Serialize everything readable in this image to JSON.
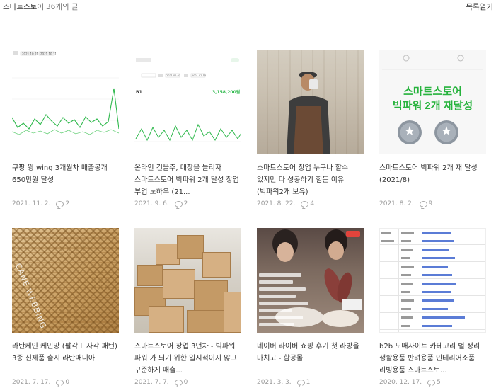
{
  "header": {
    "title": "스마트스토어",
    "count": "36개의 글",
    "list_open": "목록열기"
  },
  "posts": [
    {
      "title": "쿠팡 윙 wing 3개월차 매출공개 650만원 달성",
      "date": "2021. 11. 2.",
      "comments": "2",
      "thumb": {
        "type": "line-chart",
        "date_from": "2021.10.01",
        "date_to": "2021.10.31",
        "accent": "#2db84b"
      }
    },
    {
      "title": "온라인 건물주, 매장을 늘리자 스마트스토어 빅파워 2개 달성 창업 부업 노하우 (21...",
      "date": "2021. 9. 6.",
      "comments": "2",
      "thumb": {
        "type": "line-chart",
        "date_from": "2021.02.01",
        "date_to": "2021.02.15",
        "total": "3,158,200원",
        "label": "B1",
        "accent": "#2db84b"
      }
    },
    {
      "title": "스마트스토어 창업 누구나 할수 있지만 다 성공하기 힘든 이유 (빅파워2개 보유)",
      "date": "2021. 8. 22.",
      "comments": "4",
      "thumb": {
        "type": "photo",
        "alt": "mirror selfie person in apron"
      }
    },
    {
      "title": "스마트스토어 빅파워 2개 재 달성 (2021/8)",
      "date": "2021. 8. 2.",
      "comments": "9",
      "thumb": {
        "type": "badge",
        "line1": "스마트스토어",
        "line2": "빅파워 2개 재달성",
        "accent": "#27b33d"
      }
    },
    {
      "title": "라탄케인 케인망 (팔각 L 사각 패턴) 3종 신제품 출시 라탄매니아",
      "date": "2021. 7. 17.",
      "comments": "0",
      "thumb": {
        "type": "photo",
        "alt": "rattan cane webbing",
        "caption": "CANE WEBBING"
      }
    },
    {
      "title": "스마트스토어 창업 3년차 - 빅파워 파워 가 되기 위한 일시적이지 않고 꾸준하게 매출...",
      "date": "2021. 7. 7.",
      "comments": "0",
      "thumb": {
        "type": "photo",
        "alt": "stacked cardboard boxes"
      }
    },
    {
      "title": "네이버 라이버 쇼핑 후기 첫 라방을 마치고 - 함공몰",
      "date": "2021. 3. 3.",
      "comments": "1",
      "thumb": {
        "type": "photo",
        "alt": "live shopping broadcast"
      }
    },
    {
      "title": "b2b 도매사이트 카테고리 별 정리 생활용품 반려용품 인테리어소품 리빙용품 스마트스토...",
      "date": "2020. 12. 17.",
      "comments": "5",
      "thumb": {
        "type": "spreadsheet",
        "alt": "list of wholesale site links"
      }
    }
  ]
}
